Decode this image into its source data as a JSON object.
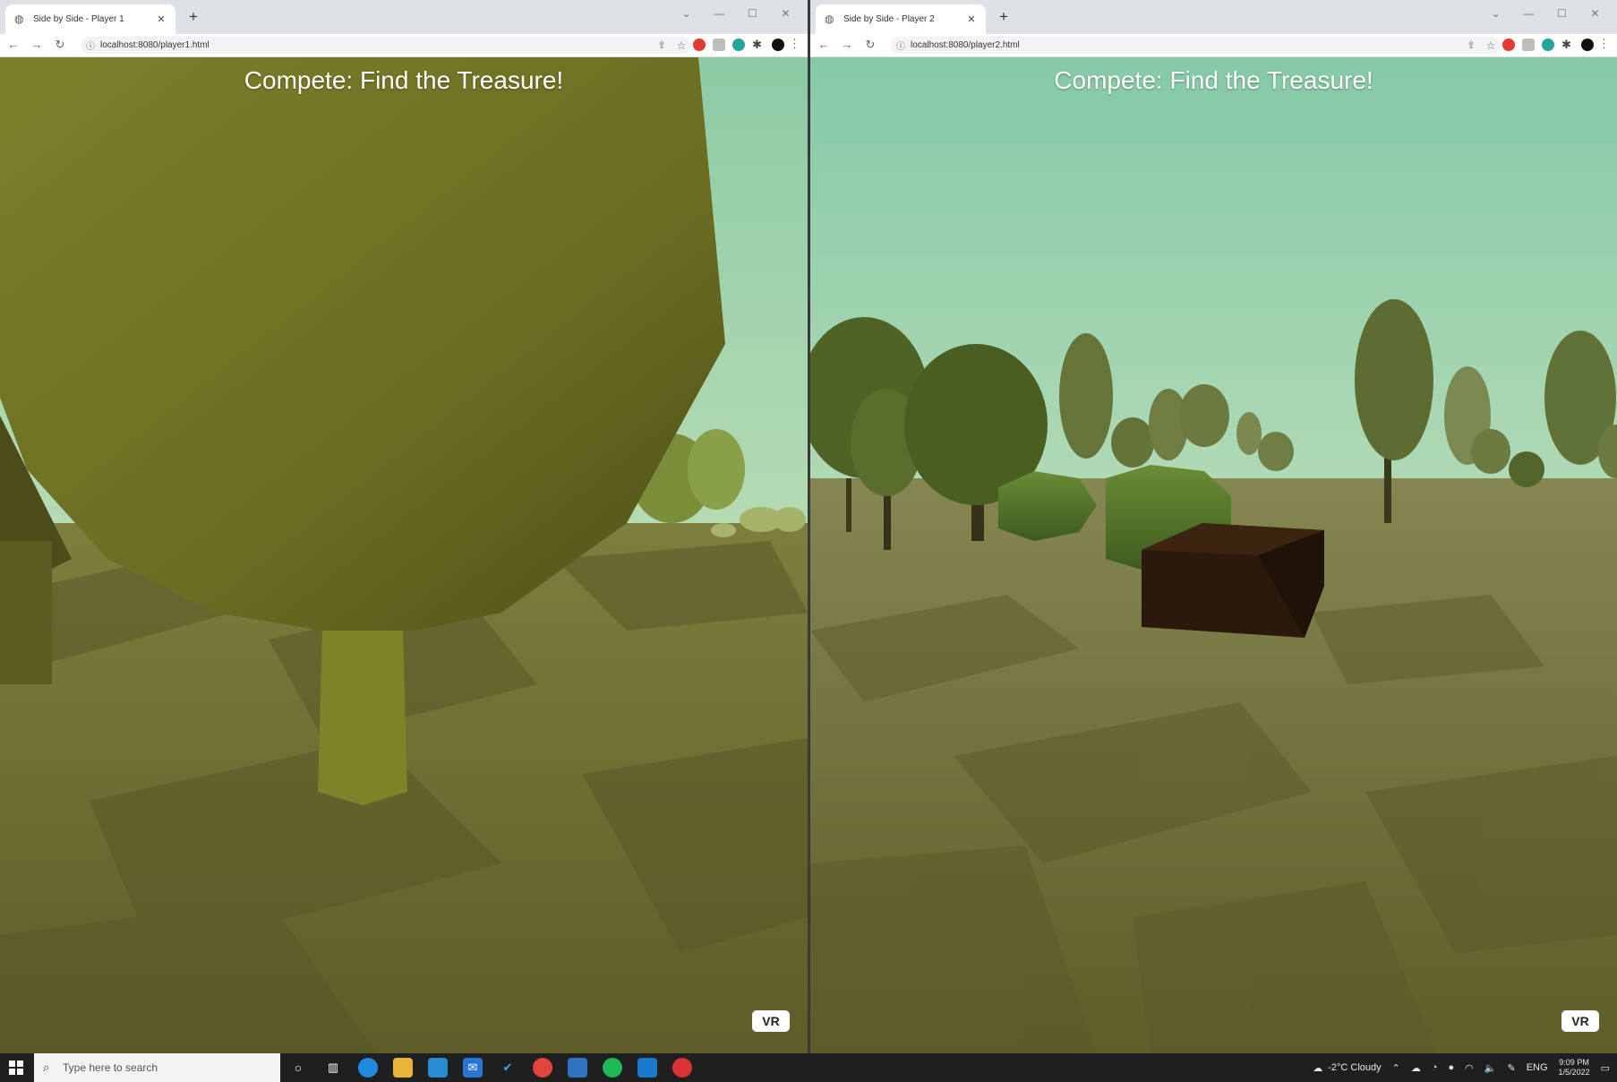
{
  "colors": {
    "sky_top": "#85c9a8",
    "sky_bottom": "#e8efc4",
    "ground": "#6e6e32",
    "treasure": "#2b1a0b",
    "tree": "#5d6a2a"
  },
  "windows": [
    {
      "tab_title": "Side by Side - Player 1",
      "url": "localhost:8080/player1.html",
      "scene_title": "Compete: Find the Treasure!",
      "vr_label": "VR"
    },
    {
      "tab_title": "Side by Side - Player 2",
      "url": "localhost:8080/player2.html",
      "scene_title": "Compete: Find the Treasure!",
      "vr_label": "VR"
    }
  ],
  "taskbar": {
    "search_placeholder": "Type here to search",
    "pinned_icons": [
      "cortana-icon",
      "task-view-icon",
      "edge-icon",
      "file-explorer-icon",
      "store-icon",
      "mail-icon",
      "todo-icon",
      "chrome-icon",
      "calendar-icon",
      "spotify-icon",
      "vscode-icon",
      "app-icon"
    ],
    "weather": "-2°C Cloudy",
    "language": "ENG",
    "time": "9:09 PM",
    "date": "1/5/2022"
  }
}
